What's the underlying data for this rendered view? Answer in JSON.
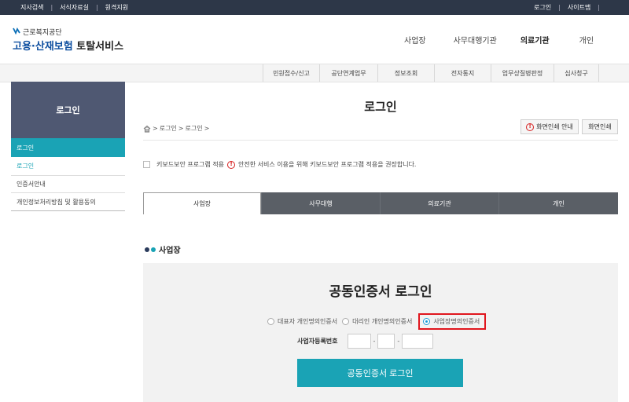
{
  "topbar": {
    "left_links": [
      "지사검색",
      "서식자료실",
      "원격지원"
    ],
    "right_links": [
      "로그인",
      "사이트맵"
    ]
  },
  "header": {
    "org_name": "근로복지공단",
    "service_name_part1": "고용·산재보험",
    "service_name_part2": "토탈서비스",
    "nav": [
      "사업장",
      "사무대행기관",
      "의료기관",
      "개인"
    ]
  },
  "subnav": {
    "items": [
      "민원접수/신고",
      "공단연계업무",
      "정보조회",
      "전자통지",
      "업무상질병판정",
      "심사청구"
    ]
  },
  "sidebar": {
    "title": "로그인",
    "active_item": "로그인",
    "items": [
      "로그인",
      "인증서안내",
      "개인정보처리방침 및 활용동의"
    ]
  },
  "content": {
    "page_title": "로그인",
    "breadcrumb": [
      "로그인",
      "로그인"
    ],
    "guide_button": "화면인쇄 안내",
    "print_button": "화면인쇄",
    "keyboard_security_label": "키보드보안 프로그램 적용",
    "keyboard_security_notice": "안전한 서비스 이용을 위해 키보드보안 프로그램 적용을 권장합니다.",
    "tabs": [
      "사업장",
      "사무대행",
      "의료기관",
      "개인"
    ],
    "active_tab": "사업장",
    "section_title": "사업장"
  },
  "login": {
    "title": "공동인증서 로그인",
    "cert_options": [
      "대표자 개인명의인증서",
      "대리인 개인명의인증서",
      "사업장명의인증서"
    ],
    "selected_option": "사업장명의인증서",
    "biz_number_label": "사업자등록번호",
    "biz_dash": "-",
    "login_button": "공동인증서 로그인"
  },
  "colors": {
    "teal": "#1aa3b5",
    "dark_bar": "#2d3748",
    "sidebar_head": "#4f5872",
    "tab_dark": "#5a5f66",
    "highlight_red": "#e0161e",
    "dot_dark": "#2a3b5c",
    "dot_teal": "#1aa3b5"
  },
  "icons": {
    "home": "home-icon",
    "warning": "warning-circle-icon",
    "checkbox": "checkbox-icon"
  }
}
